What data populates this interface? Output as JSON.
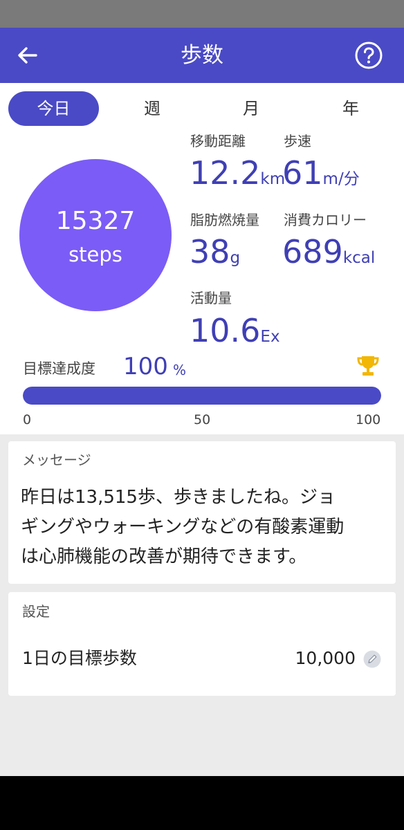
{
  "header": {
    "title": "歩数",
    "back_icon": "arrow-left-icon",
    "help_icon": "question-circle-icon"
  },
  "tabs": [
    {
      "label": "今日",
      "active": true
    },
    {
      "label": "週",
      "active": false
    },
    {
      "label": "月",
      "active": false
    },
    {
      "label": "年",
      "active": false
    }
  ],
  "steps": {
    "count": "15327",
    "unit": "steps"
  },
  "stats": {
    "distance": {
      "label": "移動距離",
      "value": "12.2",
      "unit": "km"
    },
    "pace": {
      "label": "歩速",
      "value": "61",
      "unit": "m/分"
    },
    "fat": {
      "label": "脂肪燃焼量",
      "value": "38",
      "unit": "g"
    },
    "calories": {
      "label": "消費カロリー",
      "value": "689",
      "unit": "kcal"
    },
    "activity": {
      "label": "活動量",
      "value": "10.6",
      "unit": "Ex"
    }
  },
  "goal": {
    "label": "目標達成度",
    "value": "100",
    "unit": "%",
    "fraction": 1.0,
    "ticks": [
      "0",
      "50",
      "100"
    ],
    "trophy_icon": "trophy-icon"
  },
  "message": {
    "title": "メッセージ",
    "lines": [
      "昨日は13,515歩、歩きましたね。ジョ",
      "ギングやウォーキングなどの有酸素運動",
      "は心肺機能の改善が期待できます。"
    ]
  },
  "settings": {
    "title": "設定",
    "goal_steps_label": "1日の目標歩数",
    "goal_steps_value": "10,000",
    "edit_icon": "pencil-icon"
  },
  "colors": {
    "primary": "#4a4ac6",
    "circle": "#7b5cf6",
    "accent_text": "#3f3fb5",
    "trophy": "#f2b705"
  }
}
